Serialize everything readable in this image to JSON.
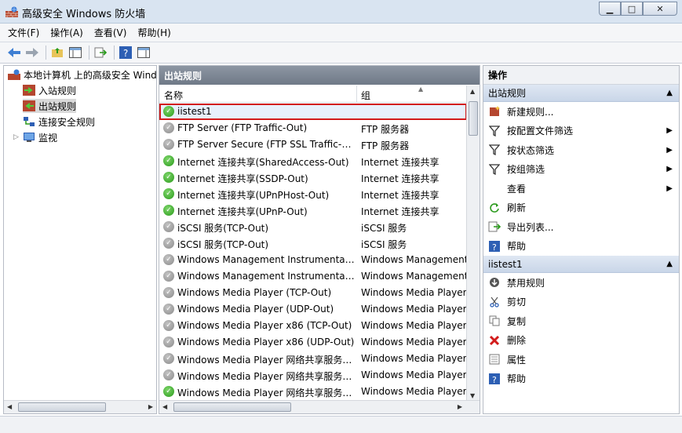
{
  "window": {
    "title": "高级安全 Windows 防火墙",
    "buttons": {
      "minimize": "▁",
      "maximize": "□",
      "close": "✕"
    }
  },
  "menu": [
    "文件(F)",
    "操作(A)",
    "查看(V)",
    "帮助(H)"
  ],
  "tree": {
    "root": "本地计算机 上的高级安全 Wind",
    "items": [
      "入站规则",
      "出站规则",
      "连接安全规则",
      "监视"
    ],
    "selected": "出站规则"
  },
  "center": {
    "title": "出站规则",
    "columns": {
      "name": "名称",
      "group": "组"
    },
    "rows": [
      {
        "name": "iistest1",
        "group": "",
        "enabled": true,
        "selected": true
      },
      {
        "name": "FTP Server (FTP Traffic-Out)",
        "group": "FTP 服务器",
        "enabled": false
      },
      {
        "name": "FTP Server Secure (FTP SSL Traffic-Out)",
        "group": "FTP 服务器",
        "enabled": false
      },
      {
        "name": "Internet 连接共享(SharedAccess-Out)",
        "group": "Internet 连接共享",
        "enabled": true
      },
      {
        "name": "Internet 连接共享(SSDP-Out)",
        "group": "Internet 连接共享",
        "enabled": true
      },
      {
        "name": "Internet 连接共享(UPnPHost-Out)",
        "group": "Internet 连接共享",
        "enabled": true
      },
      {
        "name": "Internet 连接共享(UPnP-Out)",
        "group": "Internet 连接共享",
        "enabled": true
      },
      {
        "name": "iSCSI 服务(TCP-Out)",
        "group": "iSCSI 服务",
        "enabled": false
      },
      {
        "name": "iSCSI 服务(TCP-Out)",
        "group": "iSCSI 服务",
        "enabled": false
      },
      {
        "name": "Windows Management Instrumentati...",
        "group": "Windows Management",
        "enabled": false
      },
      {
        "name": "Windows Management Instrumentati...",
        "group": "Windows Management",
        "enabled": false
      },
      {
        "name": "Windows Media Player (TCP-Out)",
        "group": "Windows Media Player",
        "enabled": false
      },
      {
        "name": "Windows Media Player (UDP-Out)",
        "group": "Windows Media Player",
        "enabled": false
      },
      {
        "name": "Windows Media Player x86 (TCP-Out)",
        "group": "Windows Media Player",
        "enabled": false
      },
      {
        "name": "Windows Media Player x86 (UDP-Out)",
        "group": "Windows Media Player",
        "enabled": false
      },
      {
        "name": "Windows Media Player 网络共享服务(...",
        "group": "Windows Media Player",
        "enabled": false
      },
      {
        "name": "Windows Media Player 网络共享服务(...",
        "group": "Windows Media Player",
        "enabled": false
      },
      {
        "name": "Windows Media Player 网络共享服务(...",
        "group": "Windows Media Player",
        "enabled": true
      }
    ]
  },
  "actions": {
    "title": "操作",
    "section1": {
      "title": "出站规则",
      "items": [
        {
          "label": "新建规则...",
          "icon": "new-rule-icon",
          "submenu": false
        },
        {
          "label": "按配置文件筛选",
          "icon": "filter-icon",
          "submenu": true
        },
        {
          "label": "按状态筛选",
          "icon": "filter-icon",
          "submenu": true
        },
        {
          "label": "按组筛选",
          "icon": "filter-icon",
          "submenu": true
        },
        {
          "label": "查看",
          "icon": "",
          "submenu": true
        },
        {
          "label": "刷新",
          "icon": "refresh-icon",
          "submenu": false
        },
        {
          "label": "导出列表...",
          "icon": "export-icon",
          "submenu": false
        },
        {
          "label": "帮助",
          "icon": "help-icon",
          "submenu": false
        }
      ]
    },
    "section2": {
      "title": "iistest1",
      "items": [
        {
          "label": "禁用规则",
          "icon": "disable-icon"
        },
        {
          "label": "剪切",
          "icon": "cut-icon"
        },
        {
          "label": "复制",
          "icon": "copy-icon"
        },
        {
          "label": "删除",
          "icon": "delete-icon"
        },
        {
          "label": "属性",
          "icon": "properties-icon"
        },
        {
          "label": "帮助",
          "icon": "help-icon"
        }
      ]
    }
  },
  "colors": {
    "selection_outline": "#d21b1b",
    "enabled_green": "#2a9a1b",
    "disabled_gray": "#8a8a8a",
    "pane_header": "#7b8491"
  }
}
